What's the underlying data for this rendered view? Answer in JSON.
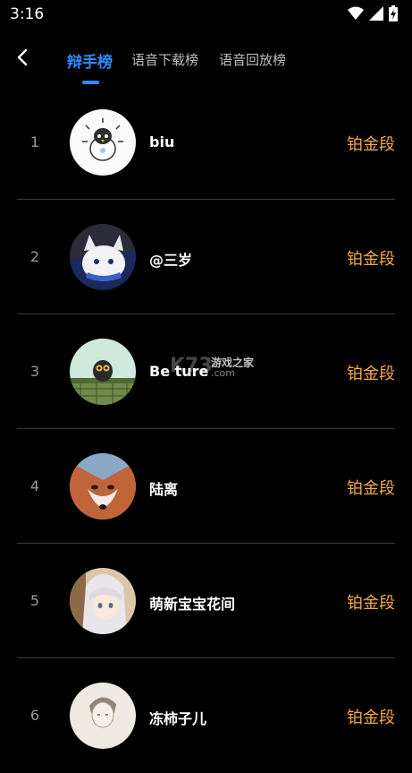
{
  "status": {
    "time": "3:16"
  },
  "tabs": [
    {
      "label": "辩手榜",
      "active": true
    },
    {
      "label": "语音下载榜",
      "active": false
    },
    {
      "label": "语音回放榜",
      "active": false
    }
  ],
  "rows": [
    {
      "rank": "1",
      "name": "biu",
      "level": "铂金段",
      "avatar": "penguin-avatar"
    },
    {
      "rank": "2",
      "name": "@三岁",
      "level": "铂金段",
      "avatar": "anime-cat-avatar"
    },
    {
      "rank": "3",
      "name": "Be ture",
      "level": "铂金段",
      "avatar": "owl-avatar"
    },
    {
      "rank": "4",
      "name": "陆离",
      "level": "铂金段",
      "avatar": "fox-avatar"
    },
    {
      "rank": "5",
      "name": "萌新宝宝花间",
      "level": "铂金段",
      "avatar": "anime-girl-avatar"
    },
    {
      "rank": "6",
      "name": "冻柿子儿",
      "level": "铂金段",
      "avatar": "sketch-portrait-avatar"
    }
  ],
  "watermark": {
    "logo": "K73",
    "site": "游戏之家",
    "domain": ".com"
  },
  "colors": {
    "accent": "#2f8cff",
    "level": "#f5a94b",
    "divider": "#3a3a3a"
  }
}
